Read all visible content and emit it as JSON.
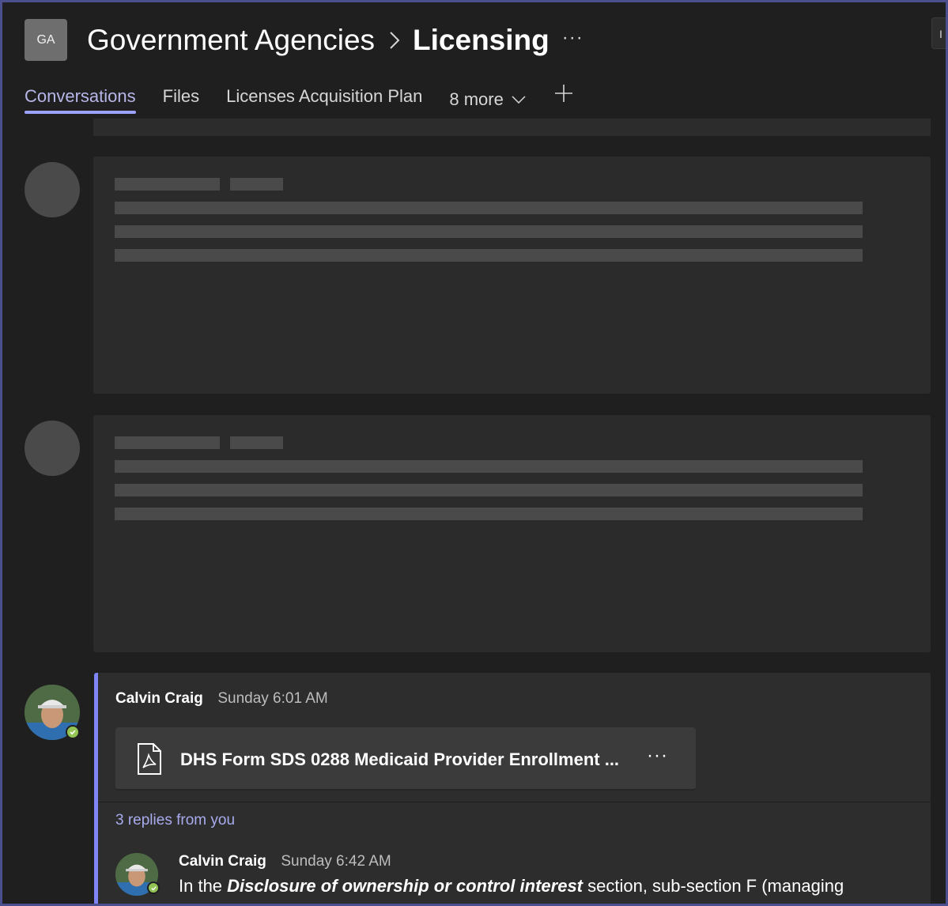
{
  "header": {
    "team_initials": "GA",
    "team_name": "Government Agencies",
    "channel_name": "Licensing",
    "more_label": "···",
    "corner_label": "I"
  },
  "tabs": {
    "items": [
      {
        "label": "Conversations",
        "active": true
      },
      {
        "label": "Files",
        "active": false
      },
      {
        "label": "Licenses Acquisition Plan",
        "active": false
      }
    ],
    "more_label": "8 more"
  },
  "thread": {
    "author": "Calvin Craig",
    "time": "Sunday 6:01 AM",
    "file_name": "DHS Form SDS 0288 Medicaid Provider Enrollment ...",
    "file_type": "pdf-icon",
    "file_more": "···",
    "replies_label": "3 replies from you",
    "reply": {
      "author": "Calvin Craig",
      "time": "Sunday 6:42 AM",
      "text_before": "In the ",
      "text_emphasis": "Disclosure of ownership or control interest",
      "text_after": " section, sub-section F (managing"
    }
  },
  "colors": {
    "accent": "#7f85f5",
    "active_tab": "#b6b7e8",
    "presence": "#92c353",
    "background": "#1f1f1f"
  }
}
